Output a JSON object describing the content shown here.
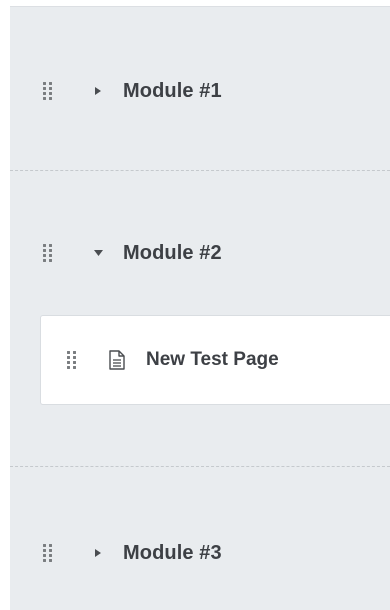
{
  "modules": [
    {
      "label": "Module #1",
      "expanded": false,
      "drag_icon": "drag-handle-icon",
      "toggle_icon": "caret-right-icon"
    },
    {
      "label": "Module #2",
      "expanded": true,
      "drag_icon": "drag-handle-icon",
      "toggle_icon": "caret-down-icon"
    },
    {
      "label": "Module #3",
      "expanded": false,
      "drag_icon": "drag-handle-icon",
      "toggle_icon": "caret-right-icon"
    }
  ],
  "pages": [
    {
      "label": "New Test Page",
      "icon": "document-icon",
      "drag_icon": "drag-handle-icon"
    }
  ],
  "colors": {
    "panel_background": "#e9ecef",
    "text": "#3d4045",
    "icon": "#7a7d80",
    "card_background": "#ffffff"
  }
}
